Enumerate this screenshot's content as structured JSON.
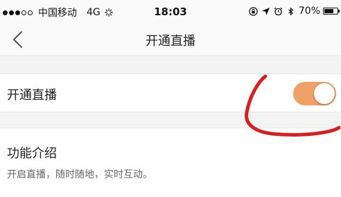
{
  "status_bar": {
    "carrier": "中国移动",
    "network": "4G",
    "time": "18:03",
    "battery_percent_label": "70%",
    "battery_level": 0.7,
    "signal_bars_filled": 3,
    "signal_bars_total": 5,
    "icons": [
      "activity-spinner-icon",
      "orientation-lock-icon",
      "location-arrow-icon",
      "alarm-icon",
      "bluetooth-icon",
      "battery-icon"
    ]
  },
  "nav": {
    "back_icon": "chevron-left-icon",
    "title": "开通直播"
  },
  "setting": {
    "label": "开通直播",
    "toggle_on": true,
    "toggle_color": "#f0a167"
  },
  "description": {
    "title": "功能介绍",
    "text": "开启直播，随时随地，实时互动。"
  },
  "annotation": {
    "color": "#d81e1e",
    "shape": "hand-drawn-red-stroke"
  }
}
